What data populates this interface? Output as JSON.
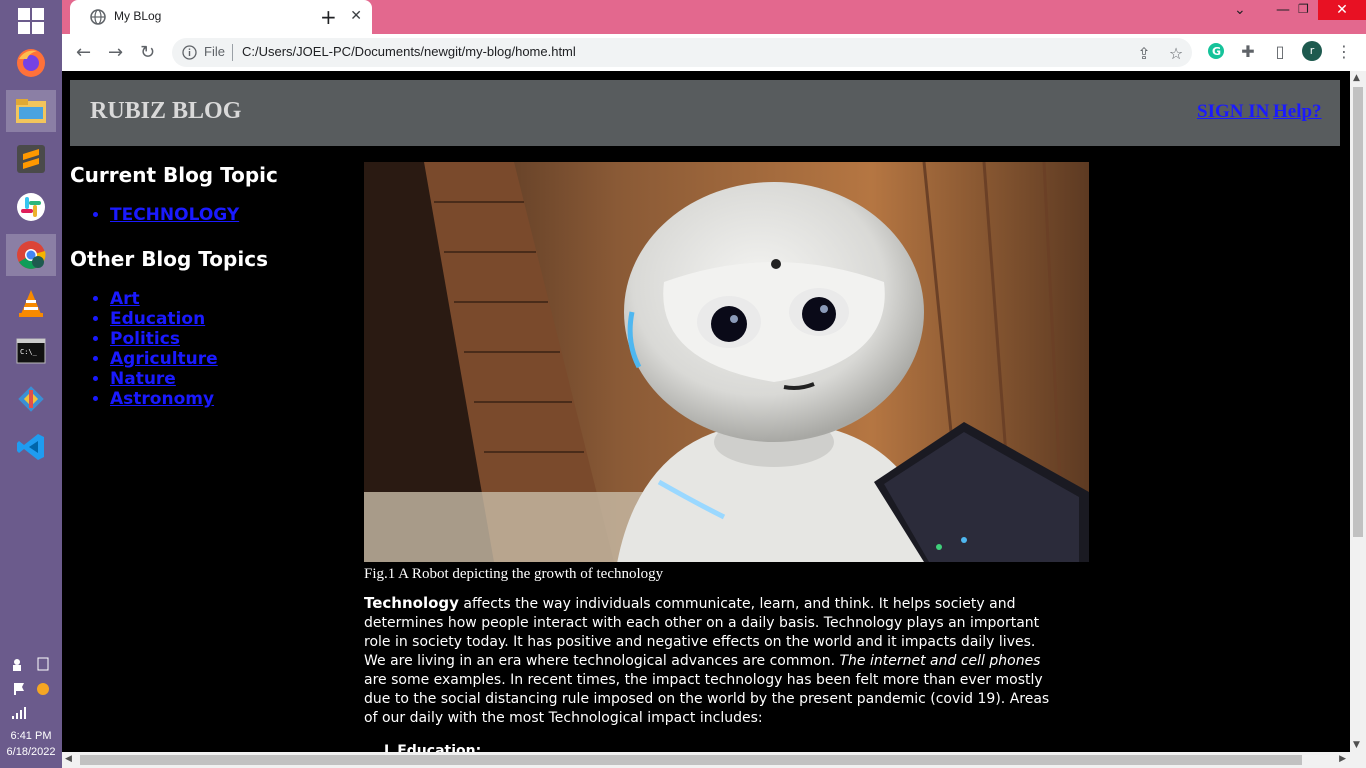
{
  "browser": {
    "tab_title": "My BLog",
    "omnibox_scheme": "File",
    "url": "C:/Users/JOEL-PC/Documents/newgit/my-blog/home.html",
    "profile_initial": "r"
  },
  "taskbar": {
    "apps": [
      "windows-start",
      "firefox",
      "file-explorer",
      "sublime-text",
      "slack",
      "chrome",
      "vlc",
      "command-prompt",
      "git",
      "vscode"
    ],
    "time": "6:41 PM",
    "date": "6/18/2022"
  },
  "site": {
    "title": "RUBIZ BLOG",
    "nav": [
      "SIGN IN",
      "Help?"
    ],
    "current_heading": "Current Blog Topic",
    "current_topic": "TECHNOLOGY",
    "other_heading": "Other Blog Topics",
    "other_topics": [
      "Art",
      "Education",
      "Politics",
      "Agriculture",
      "Nature",
      "Astronomy"
    ],
    "figure_caption": "Fig.1 A Robot depicting the growth of technology",
    "article": {
      "lead": "Technology",
      "part1": " affects the way individuals communicate, learn, and think. It helps society and determines how people interact with each other on a daily basis. Technology plays an important role in society today. It has positive and negative effects on the world and it impacts daily lives. We are living in an era where technological advances are common. ",
      "italic": "The internet and cell phones",
      "part2": " are some examples. In recent times, the impact technology has been felt more than ever mostly due to the social distancing rule imposed on the world by the present pandemic (covid 19). Areas of our daily with the most Technological impact includes:",
      "list_first": "Education:"
    }
  },
  "colors": {
    "tab_strip": "#e3688e",
    "header_bg": "#585c5e",
    "link": "#1a1aff",
    "page_bg": "#000000"
  }
}
